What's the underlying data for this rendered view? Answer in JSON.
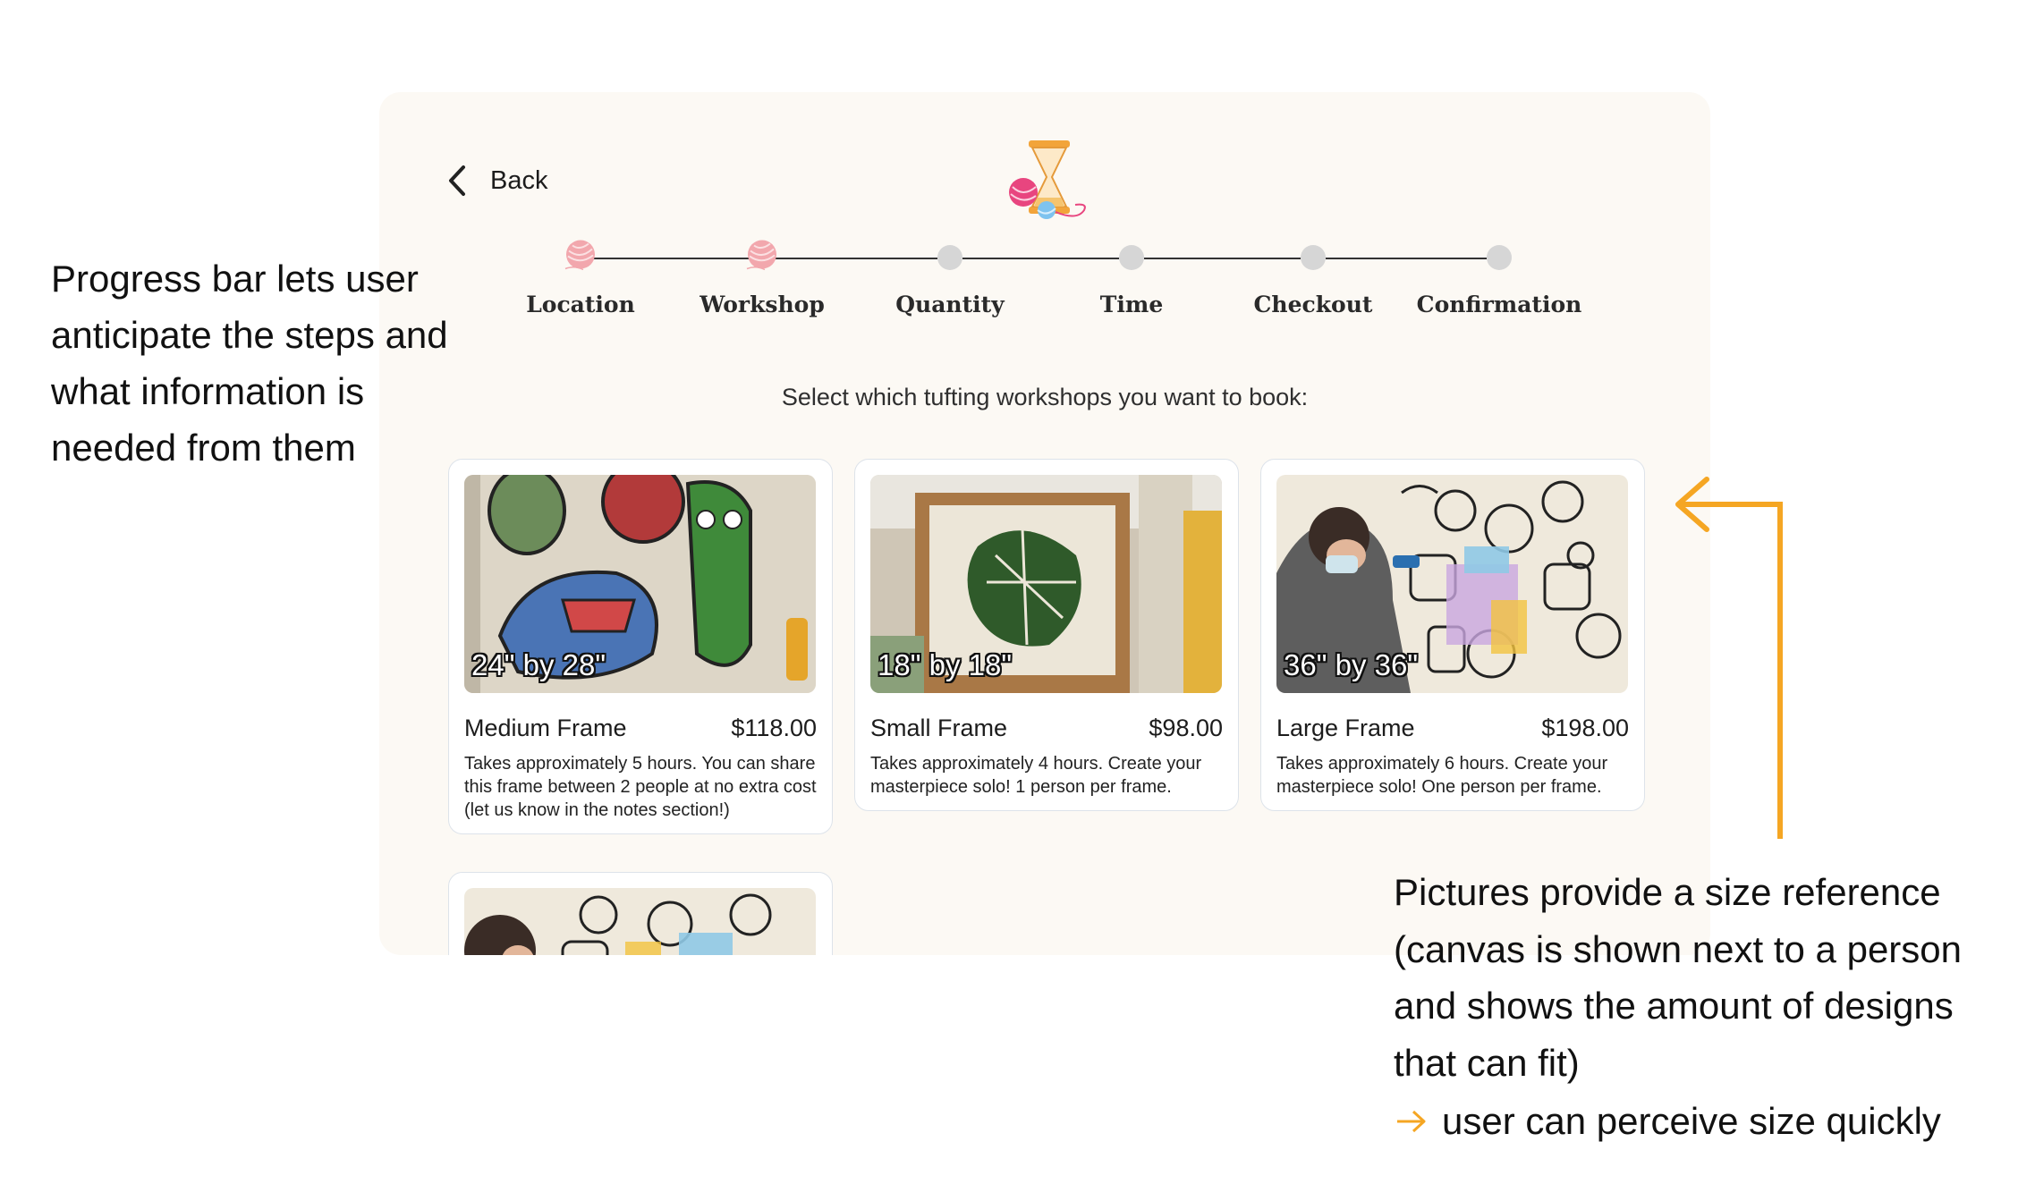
{
  "back": {
    "label": "Back"
  },
  "progress": {
    "steps": [
      {
        "label": "Location",
        "state": "complete"
      },
      {
        "label": "Workshop",
        "state": "complete"
      },
      {
        "label": "Quantity",
        "state": "pending"
      },
      {
        "label": "Time",
        "state": "pending"
      },
      {
        "label": "Checkout",
        "state": "pending"
      },
      {
        "label": "Confirmation",
        "state": "pending"
      }
    ]
  },
  "prompt": "Select which tufting workshops you want to book:",
  "workshops": [
    {
      "size": "24\" by 28\"",
      "title": "Medium Frame",
      "price": "$118.00",
      "description": "Takes approximately 5 hours. You can share this frame between 2 people at no extra cost (let us know in the notes section!)"
    },
    {
      "size": "18\" by 18\"",
      "title": "Small Frame",
      "price": "$98.00",
      "description": "Takes approximately 4 hours. Create your masterpiece solo! 1 person per frame."
    },
    {
      "size": "36\" by 36\"",
      "title": "Large Frame",
      "price": "$198.00",
      "description": "Takes approximately 6 hours. Create your masterpiece solo! One person per frame."
    }
  ],
  "annotations": {
    "left": "Progress bar lets user anticipate the steps and what information is needed from them",
    "right": "Pictures provide a size reference (canvas is shown next to a person and shows the amount of designs that can fit)",
    "right_conclusion": "user can perceive size quickly"
  },
  "colors": {
    "accent_arrow": "#f5a623",
    "frame_bg": "#fcf9f4",
    "pending_dot": "#d6d6d6",
    "yarn": "#f2a7ad"
  }
}
